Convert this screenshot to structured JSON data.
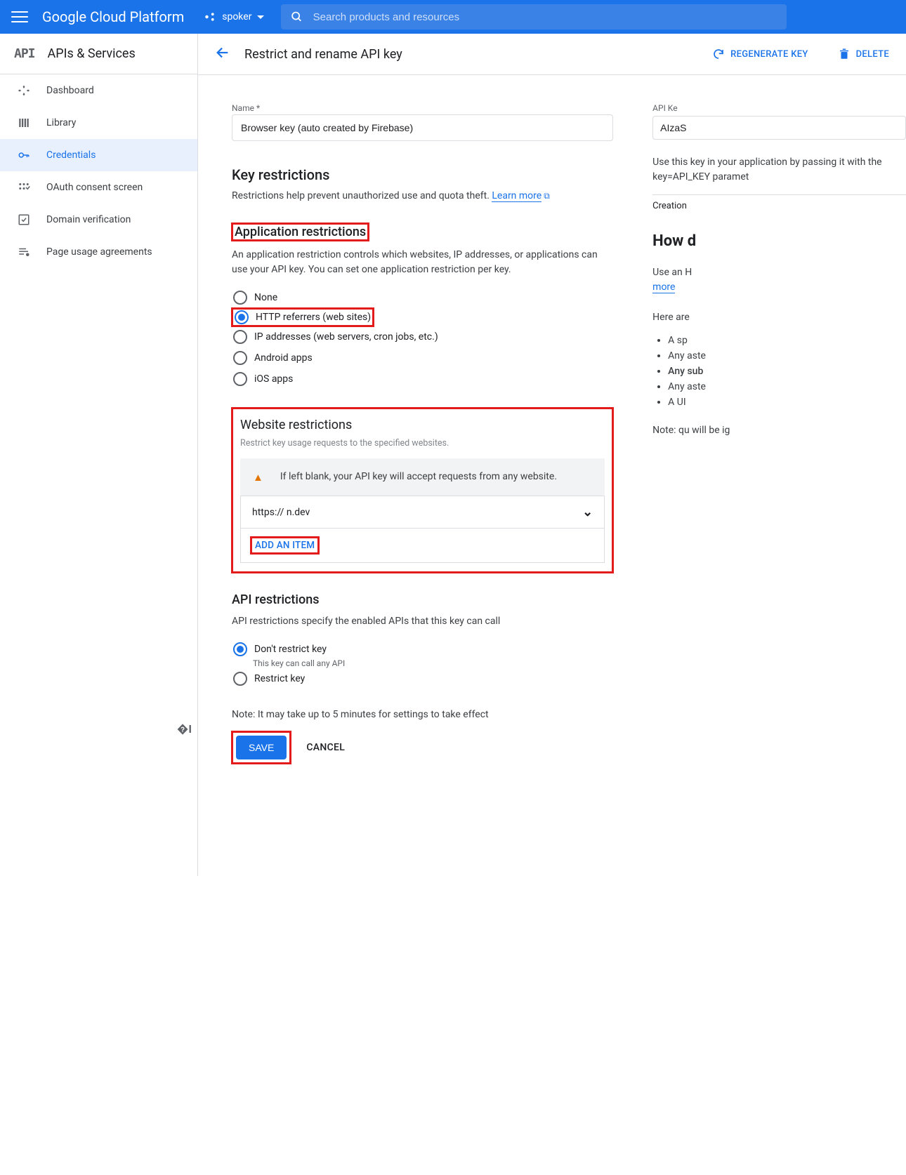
{
  "topbar": {
    "brand": "Google Cloud Platform",
    "project": "spoker",
    "search_placeholder": "Search products and resources"
  },
  "sidebar": {
    "section": "APIs & Services",
    "items": [
      {
        "label": "Dashboard"
      },
      {
        "label": "Library"
      },
      {
        "label": "Credentials"
      },
      {
        "label": "OAuth consent screen"
      },
      {
        "label": "Domain verification"
      },
      {
        "label": "Page usage agreements"
      }
    ]
  },
  "page": {
    "title": "Restrict and rename API key",
    "regenerate": "REGENERATE KEY",
    "delete": "DELETE"
  },
  "form": {
    "name_label": "Name *",
    "name_value": "Browser key (auto created by Firebase)",
    "key_restrictions_heading": "Key restrictions",
    "key_restrictions_desc": "Restrictions help prevent unauthorized use and quota theft. ",
    "learn_more": "Learn more",
    "app_restrictions_heading": "Application restrictions",
    "app_restrictions_desc": "An application restriction controls which websites, IP addresses, or applications can use your API key. You can set one application restriction per key.",
    "app_options": {
      "none": "None",
      "http": "HTTP referrers (web sites)",
      "ip": "IP addresses (web servers, cron jobs, etc.)",
      "android": "Android apps",
      "ios": "iOS apps"
    },
    "website": {
      "heading": "Website restrictions",
      "hint": "Restrict key usage requests to the specified websites.",
      "warning": "If left blank, your API key will accept requests from any website.",
      "entry": "https://                n.dev",
      "add_item": "ADD AN ITEM"
    },
    "api_restrictions_heading": "API restrictions",
    "api_restrictions_desc": "API restrictions specify the enabled APIs that this key can call",
    "api_options": {
      "dont": "Don't restrict key",
      "dont_sub": "This key can call any API",
      "restrict": "Restrict key"
    },
    "note": "Note: It may take up to 5 minutes for settings to take effect",
    "save": "SAVE",
    "cancel": "CANCEL"
  },
  "right": {
    "api_key_label": "API Ke",
    "api_key_value": "AIzaS",
    "use_desc": "Use this key in your application by passing it with the key=API_KEY paramet",
    "creation": "Creation",
    "how_heading": "How d",
    "use_an": "Use an H",
    "more": "more",
    "here_are": "Here are",
    "tips": [
      "A sp",
      "Any aste",
      "Any sub",
      "Any aste",
      "A UI"
    ],
    "note": "Note: qu will be ig"
  }
}
